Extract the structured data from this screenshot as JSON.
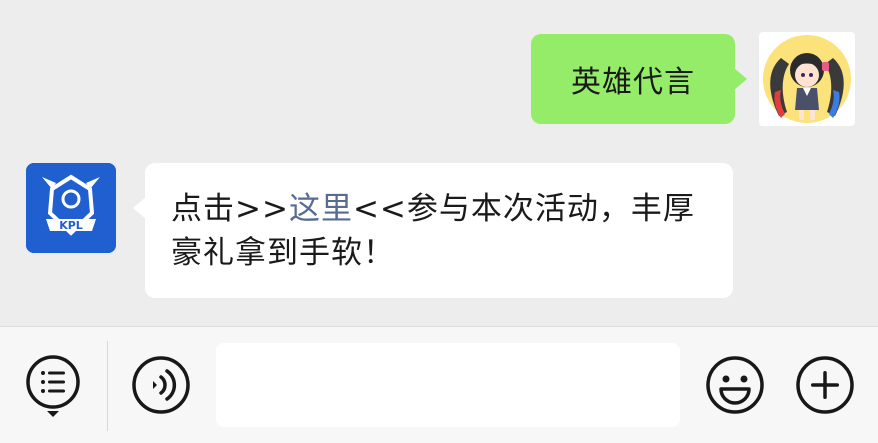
{
  "messages": {
    "outgoing": {
      "text": "英雄代言"
    },
    "incoming": {
      "prefix": "点击>>",
      "link_text": "这里",
      "suffix": "<<参与本次活动，丰厚豪礼拿到手软！",
      "avatar_label": "KPL"
    }
  },
  "input": {
    "value": ""
  },
  "icons": {
    "menu": "menu-list-icon",
    "voice": "voice-icon",
    "emoji": "emoji-icon",
    "more": "plus-icon"
  },
  "colors": {
    "outgoing_bubble": "#95ec69",
    "incoming_bubble": "#ffffff",
    "link": "#576b95",
    "kpl_blue": "#1f5fd0"
  }
}
